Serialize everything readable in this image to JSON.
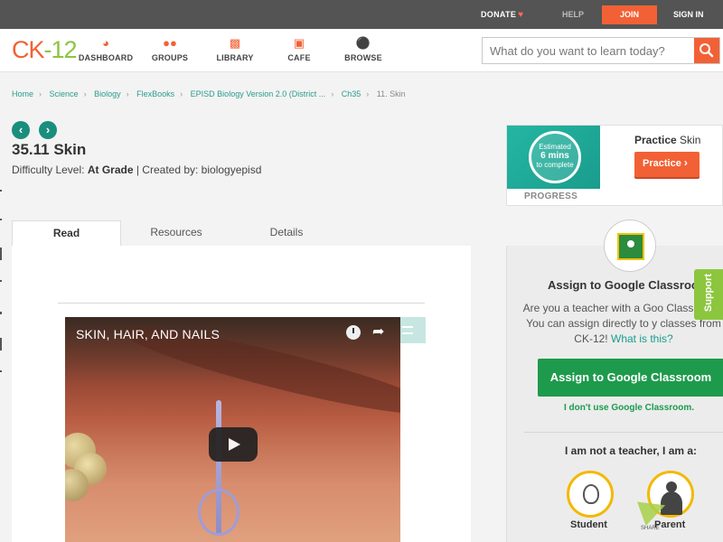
{
  "topbar": {
    "donate": "DONATE",
    "help": "HELP",
    "join": "JOIN",
    "signin": "SIGN IN"
  },
  "nav": {
    "logo_ck": "CK",
    "logo_dash": "-",
    "logo_12": "12",
    "items": [
      {
        "label": "DASHBOARD",
        "icon": "dashboard-icon"
      },
      {
        "label": "GROUPS",
        "icon": "groups-icon"
      },
      {
        "label": "LIBRARY",
        "icon": "library-icon"
      },
      {
        "label": "CAFE",
        "icon": "cafe-icon"
      },
      {
        "label": "BROWSE",
        "icon": "browse-icon"
      }
    ],
    "search_placeholder": "What do you want to learn today?"
  },
  "breadcrumb": [
    "Home",
    "Science",
    "Biology",
    "FlexBooks",
    "EPISD Biology Version 2.0 (District ...",
    "Ch35",
    "11. Skin"
  ],
  "page": {
    "title": "35.11 Skin",
    "difficulty_label": "Difficulty Level:",
    "difficulty_value": "At Grade",
    "created_by": "| Created by: biologyepisd"
  },
  "tabs": [
    "Read",
    "Resources",
    "Details"
  ],
  "video": {
    "title": "SKIN, HAIR, AND NAILS"
  },
  "practice": {
    "estimated_line1": "Estimated",
    "estimated_line2": "6 mins",
    "estimated_line3": "to complete",
    "progress": "PROGRESS",
    "title_bold": "Practice",
    "title_rest": " Skin",
    "button": "Practice"
  },
  "classroom": {
    "title": "Assign to Google Classroo",
    "text": "Are you a teacher with a Goo Classroom? You can assign directly to y classes from CK-12!",
    "link": "What is this?",
    "button": "Assign to Google Classroom",
    "no_use": "I don't use Google Classroom.",
    "not_teacher": "I am not a teacher, I am a:",
    "student": "Student",
    "parent": "Parent",
    "share": "SHARE"
  },
  "support": "Support",
  "colors": {
    "accent_orange": "#f26135",
    "teal": "#1a9c8c",
    "green": "#1e9a4c"
  }
}
